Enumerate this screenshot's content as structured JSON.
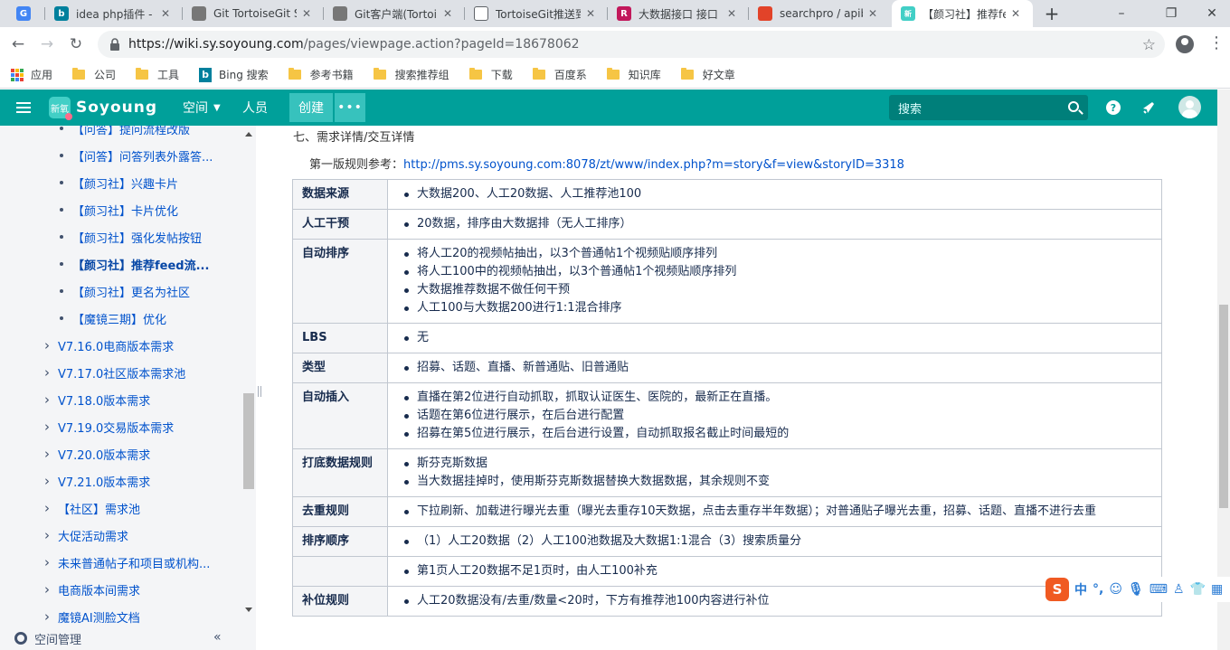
{
  "browser": {
    "tabs": [
      {
        "label": "",
        "fav": "G",
        "color": "#4285f4"
      },
      {
        "label": "idea php插件 - B",
        "fav": "b",
        "color": "#00809d"
      },
      {
        "label": "Git TortoiseGit S",
        "fav": "",
        "color": "#777777"
      },
      {
        "label": "Git客户端(Tortoi",
        "fav": "",
        "color": "#777777"
      },
      {
        "label": "TortoiseGit推送到",
        "fav": "",
        "color": "#5f6368"
      },
      {
        "label": "大数据接口 接口",
        "fav": "R",
        "color": "#c2185b"
      },
      {
        "label": "searchpro / apib",
        "fav": "",
        "color": "#e24329"
      },
      {
        "label": "【颜习社】推荐fe",
        "fav": "新",
        "color": "#42cfc6"
      }
    ],
    "tab_close": "✕",
    "new_tab": "+",
    "win_min": "–",
    "win_max": "❐",
    "win_close": "✕",
    "url_host": "https://wiki.sy.soyoung.com",
    "url_path": "/pages/viewpage.action?pageId=18678062",
    "bookmarks": [
      "应用",
      "公司",
      "工具",
      "Bing 搜索",
      "参考书籍",
      "搜索推荐组",
      "下载",
      "百度系",
      "知识库",
      "好文章"
    ]
  },
  "app": {
    "logo_badge": "新氧",
    "logo_text": "Soyoung",
    "nav_space": "空间",
    "nav_people": "人员",
    "create": "创建",
    "more": "•••",
    "search_placeholder": "搜索",
    "help": "?"
  },
  "sidebar": {
    "items": [
      {
        "label": "【问答】提问流程改版",
        "kind": "leaf"
      },
      {
        "label": "【问答】问答列表外露答...",
        "kind": "leaf"
      },
      {
        "label": "【颜习社】兴趣卡片",
        "kind": "leaf"
      },
      {
        "label": "【颜习社】卡片优化",
        "kind": "leaf"
      },
      {
        "label": "【颜习社】强化发帖按钮",
        "kind": "leaf"
      },
      {
        "label": "【颜习社】推荐feed流...",
        "kind": "leaf",
        "bold": true
      },
      {
        "label": "【颜习社】更名为社区",
        "kind": "leaf"
      },
      {
        "label": "【魔镜三期】优化",
        "kind": "leaf"
      },
      {
        "label": "V7.16.0电商版本需求",
        "kind": "branch"
      },
      {
        "label": "V7.17.0社区版本需求池",
        "kind": "branch"
      },
      {
        "label": "V7.18.0版本需求",
        "kind": "branch"
      },
      {
        "label": "V7.19.0交易版本需求",
        "kind": "branch"
      },
      {
        "label": "V7.20.0版本需求",
        "kind": "branch"
      },
      {
        "label": "V7.21.0版本需求",
        "kind": "branch"
      },
      {
        "label": "【社区】需求池",
        "kind": "branch"
      },
      {
        "label": "大促活动需求",
        "kind": "branch"
      },
      {
        "label": "未来普通帖子和项目或机构...",
        "kind": "branch"
      },
      {
        "label": "电商版本间需求",
        "kind": "branch"
      },
      {
        "label": "魔镜AI测脸文档",
        "kind": "branch"
      }
    ],
    "space_manage": "空间管理",
    "collapse": "«"
  },
  "content": {
    "section_title": "七、需求详情/交互详情",
    "ref_prefix": "第一版规则参考：",
    "ref_link": "http://pms.sy.soyoung.com:8078/zt/www/index.php?m=story&f=view&storyID=3318",
    "rows": [
      {
        "head": "数据来源",
        "items": [
          "大数据200、人工20数据、人工推荐池100"
        ]
      },
      {
        "head": "人工干预",
        "items": [
          "20数据，排序由大数据排（无人工排序）"
        ]
      },
      {
        "head": "自动排序",
        "items": [
          "将人工20的视频帖抽出，以3个普通帖1个视频贴顺序排列",
          "将人工100中的视频帖抽出，以3个普通帖1个视频贴顺序排列",
          "大数据推荐数据不做任何干预",
          "人工100与大数据200进行1:1混合排序"
        ]
      },
      {
        "head": "LBS",
        "items": [
          "无"
        ]
      },
      {
        "head": "类型",
        "items": [
          "招募、话题、直播、新普通贴、旧普通贴"
        ]
      },
      {
        "head": "自动插入",
        "items": [
          "直播在第2位进行自动抓取，抓取认证医生、医院的，最新正在直播。",
          "话题在第6位进行展示，在后台进行配置",
          "招募在第5位进行展示，在后台进行设置，自动抓取报名截止时间最短的"
        ]
      },
      {
        "head": "打底数据规则",
        "items": [
          "斯芬克斯数据",
          "当大数据挂掉时，使用斯芬克斯数据替换大数据数据，其余规则不变"
        ]
      },
      {
        "head": "去重规则",
        "items": [
          "下拉刷新、加载进行曝光去重（曝光去重存10天数据，点击去重存半年数据）；对普通贴子曝光去重，招募、话题、直播不进行去重"
        ]
      },
      {
        "head": "排序顺序",
        "items": [
          "（1）人工20数据（2）人工100池数据及大数据1:1混合（3）搜索质量分"
        ]
      },
      {
        "head": "",
        "items": [
          "第1页人工20数据不足1页时，由人工100补充"
        ]
      },
      {
        "head": "补位规则",
        "items": [
          "人工20数据没有/去重/数量<20时，下方有推荐池100内容进行补位"
        ]
      }
    ]
  },
  "ime": {
    "logo": "S",
    "mode": "中",
    "punct": "°,"
  }
}
